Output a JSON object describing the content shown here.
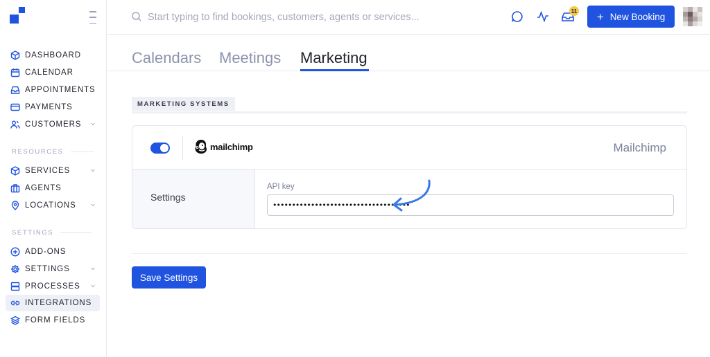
{
  "sidebar": {
    "items": [
      {
        "label": "DASHBOARD",
        "icon": "cube-icon"
      },
      {
        "label": "CALENDAR",
        "icon": "calendar-icon"
      },
      {
        "label": "APPOINTMENTS",
        "icon": "inbox-icon"
      },
      {
        "label": "PAYMENTS",
        "icon": "credit-card-icon"
      },
      {
        "label": "CUSTOMERS",
        "icon": "users-icon"
      }
    ],
    "resources_title": "RESOURCES",
    "resources": [
      {
        "label": "SERVICES",
        "icon": "box-icon"
      },
      {
        "label": "AGENTS",
        "icon": "briefcase-icon"
      },
      {
        "label": "LOCATIONS",
        "icon": "map-pin-icon"
      }
    ],
    "settings_title": "SETTINGS",
    "settings": [
      {
        "label": "ADD-ONS",
        "icon": "plus-circle-icon"
      },
      {
        "label": "SETTINGS",
        "icon": "gear-icon"
      },
      {
        "label": "PROCESSES",
        "icon": "server-icon"
      },
      {
        "label": "INTEGRATIONS",
        "icon": "link-icon",
        "active": true
      },
      {
        "label": "FORM FIELDS",
        "icon": "layers-icon"
      }
    ]
  },
  "topbar": {
    "search_placeholder": "Start typing to find bookings, customers, agents or services...",
    "notifications_count": "11",
    "new_booking_label": "New Booking",
    "new_booking_icon": "+"
  },
  "tabs": [
    {
      "label": "Calendars"
    },
    {
      "label": "Meetings"
    },
    {
      "label": "Marketing",
      "active": true
    }
  ],
  "section": {
    "title": "MARKETING SYSTEMS"
  },
  "integration": {
    "logo_text": "mailchimp",
    "name": "Mailchimp",
    "enabled": true,
    "settings_label": "Settings",
    "api_key_label": "API key",
    "api_key_value": "••••••••••••••••••••••••••••••••••••"
  },
  "actions": {
    "save_label": "Save Settings"
  },
  "colors": {
    "accent": "#1f53e0",
    "badge": "#f2c94c",
    "sidebar_active": "#eef0f7",
    "muted_text": "#8c93ac"
  }
}
